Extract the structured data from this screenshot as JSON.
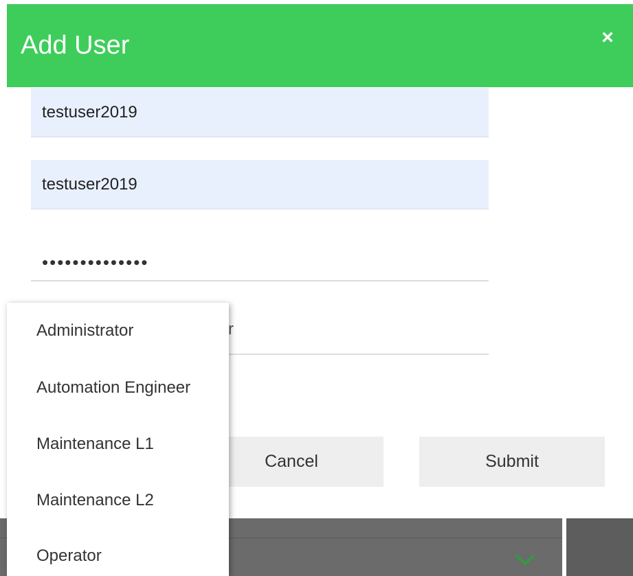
{
  "dialog": {
    "title": "Add User",
    "close_icon": "close-icon",
    "close_label": "×",
    "header_color": "#3ecd5a"
  },
  "form": {
    "username_value": "testuser2019",
    "fullname_value": "testuser2019",
    "password_value": "••••••••••••••",
    "role_peek": "r"
  },
  "buttons": {
    "cancel_label": "Cancel",
    "submit_label": "Submit"
  },
  "role_dropdown": {
    "options": [
      "Administrator",
      "Automation Engineer",
      "Maintenance L1",
      "Maintenance L2",
      "Operator"
    ]
  },
  "background": {
    "chevron_icon": "chevron-down-icon",
    "chevron_color": "#2e9e3a"
  }
}
